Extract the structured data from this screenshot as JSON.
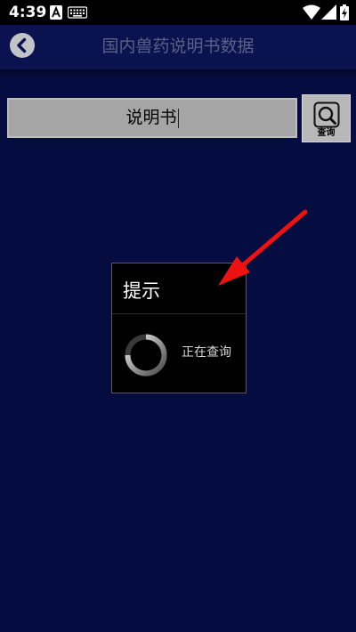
{
  "status_bar": {
    "time": "4:39"
  },
  "header": {
    "title": "国内兽药说明书数据"
  },
  "search": {
    "value": "说明书",
    "button_label": "查询"
  },
  "dialog": {
    "title": "提示",
    "message": "正在查询"
  },
  "colors": {
    "background": "#050c3f",
    "annotation_arrow": "#ee1111"
  }
}
